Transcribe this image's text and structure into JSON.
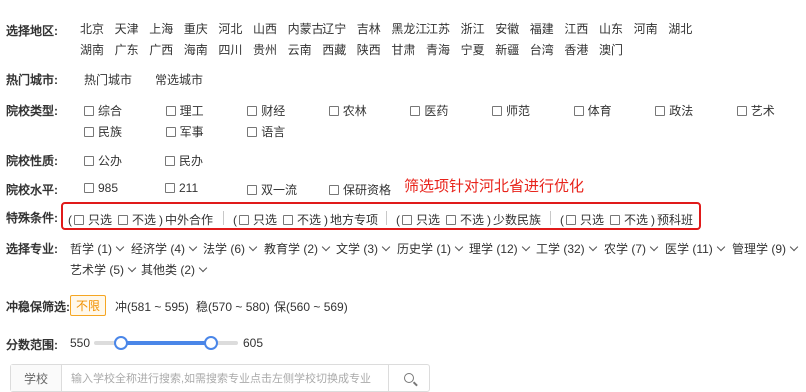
{
  "region": {
    "label": "选择地区:",
    "row1": [
      "北京",
      "天津",
      "上海",
      "重庆",
      "河北",
      "山西",
      "内蒙古",
      "辽宁",
      "吉林",
      "黑龙江",
      "江苏",
      "浙江",
      "安徽",
      "福建",
      "江西",
      "山东",
      "河南",
      "湖北"
    ],
    "row2": [
      "湖南",
      "广东",
      "广西",
      "海南",
      "四川",
      "贵州",
      "云南",
      "西藏",
      "陕西",
      "甘肃",
      "青海",
      "宁夏",
      "新疆",
      "台湾",
      "香港",
      "澳门"
    ]
  },
  "hot_city": {
    "label": "热门城市:",
    "options": [
      "热门城市",
      "常选城市"
    ]
  },
  "school_type": {
    "label": "院校类型:",
    "row1": [
      "综合",
      "理工",
      "财经",
      "农林",
      "医药",
      "师范",
      "体育",
      "政法",
      "艺术"
    ],
    "row2": [
      "民族",
      "军事",
      "语言"
    ]
  },
  "school_nature": {
    "label": "院校性质:",
    "options": [
      "公办",
      "民办"
    ]
  },
  "school_level": {
    "label": "院校水平:",
    "options": [
      "985",
      "211",
      "双一流",
      "保研资格"
    ]
  },
  "annotation": "筛选项针对河北省进行优化",
  "special": {
    "label": "特殊条件:",
    "only": "只选",
    "exclude": "不选",
    "groups": [
      "中外合作",
      "地方专项",
      "少数民族",
      "预科班"
    ]
  },
  "major": {
    "label": "选择专业:",
    "row1": [
      "哲学 (1)",
      "经济学 (4)",
      "法学 (6)",
      "教育学 (2)",
      "文学 (3)",
      "历史学 (1)",
      "理学 (12)",
      "工学 (32)",
      "农学 (7)",
      "医学 (11)",
      "管理学 (9)"
    ],
    "row2": [
      "艺术学 (5)",
      "其他类 (2)"
    ]
  },
  "risk": {
    "label": "冲稳保筛选:",
    "unlimited": "不限",
    "chong": "冲(581 ~ 595)",
    "wen": "稳(570 ~ 580)",
    "bao": "保(560 ~ 569)"
  },
  "score": {
    "label": "分数范围:",
    "min": "550",
    "max": "605"
  },
  "search": {
    "type": "学校",
    "placeholder": "输入学校全称进行搜索,如需搜索专业点击左侧学校切换成专业"
  },
  "colors": {
    "accent": "#4a86e8",
    "annotation": "#e8231b",
    "highlight_border": "#e01a1a",
    "unlimited": "#f29100"
  }
}
